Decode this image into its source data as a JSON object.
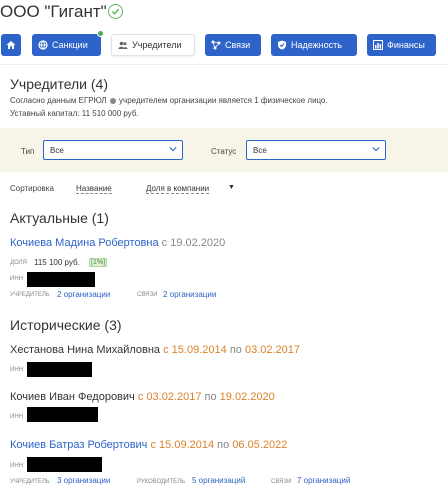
{
  "header": {
    "company": "ООО \"Гигант\""
  },
  "toolbar": {
    "home_icon": "home-icon",
    "sanctions": "Санкции",
    "founders": "Учредители",
    "links": "Связи",
    "reliability": "Надежность",
    "finances": "Финансы"
  },
  "founders": {
    "title": "Учредители (4)",
    "egrul_text_1": "Согласно данным ЕГРЮЛ",
    "egrul_text_2": "учредителем организации является 1 физическое лицо.",
    "capital": "Уставный капитал: 11 510 000 руб."
  },
  "filters": {
    "type_label": "Тип",
    "type_value": "Все",
    "status_label": "Статус",
    "status_value": "Все"
  },
  "sort": {
    "label": "Сортировка",
    "by_name": "Название",
    "by_share": "Доля в компании"
  },
  "current": {
    "title": "Актуальные (1)",
    "person": {
      "name": "Кочиева Мадина Робертовна",
      "since": "с 19.02.2020",
      "share_label": "доля",
      "share_value": "115 100 руб.",
      "share_pct": "1%",
      "inn_label": "инн",
      "founder_label": "учредитель",
      "founder_value": "2 организации",
      "links_label": "связи",
      "links_value": "2 организации"
    }
  },
  "historical": {
    "title": "Исторические (3)",
    "persons": [
      {
        "name": "Хестанова Нина Михайловна",
        "from": "с 15.09.2014",
        "to_word": "по",
        "to": "03.02.2017",
        "inn_label": "инн"
      },
      {
        "name": "Кочиев Иван Федорович",
        "from": "с 03.02.2017",
        "to_word": "по",
        "to": "19.02.2020",
        "inn_label": "инн"
      },
      {
        "name": "Кочиев Батраз Робертович",
        "from": "с 15.09.2014",
        "to_word": "по",
        "to": "06.05.2022",
        "inn_label": "инн",
        "founder_label": "учредитель",
        "founder_value": "3 организации",
        "head_label": "руководитель",
        "head_value": "5 организаций",
        "links_label": "связи",
        "links_value": "7 организаций"
      }
    ]
  },
  "colors": {
    "accent": "#2e63c9",
    "orange": "#d9822b",
    "filter_bg": "#f7f5e8"
  }
}
